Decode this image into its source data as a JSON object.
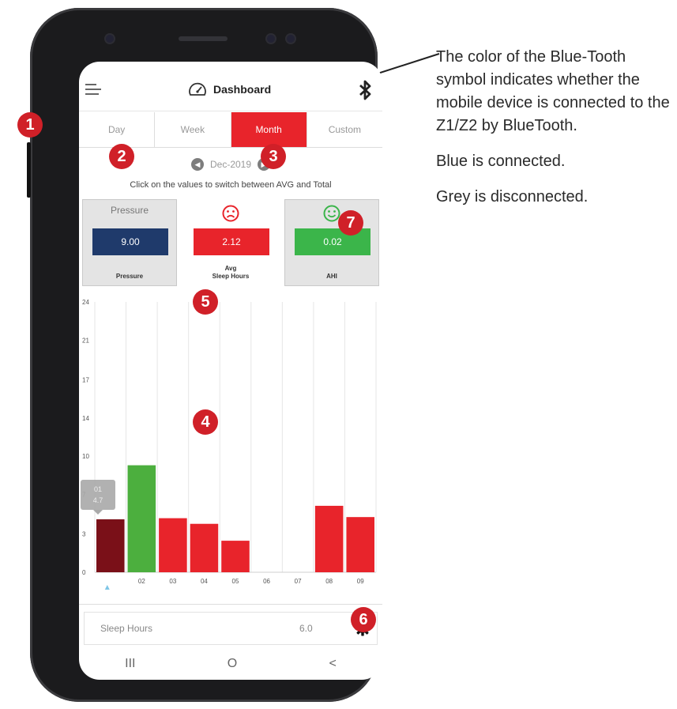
{
  "header": {
    "title": "Dashboard"
  },
  "tabs": [
    {
      "label": "Day",
      "active": false
    },
    {
      "label": "Week",
      "active": false
    },
    {
      "label": "Month",
      "active": true
    },
    {
      "label": "Custom",
      "active": false
    }
  ],
  "date_nav": {
    "current": "Dec-2019"
  },
  "instruction": "Click on the values to switch between AVG and Total",
  "cards": {
    "pressure": {
      "title": "Pressure",
      "value": "9.00",
      "label": "Pressure",
      "color": "#1f3a6b"
    },
    "sleep": {
      "value": "2.12",
      "label_line1": "Avg",
      "label_line2": "Sleep Hours",
      "color": "#e8242b",
      "face": "sad-face-icon"
    },
    "ahi": {
      "value": "0.02",
      "label": "AHI",
      "color": "#3bb54a",
      "face": "smiley-face-icon"
    }
  },
  "chart_data": {
    "type": "bar",
    "categories": [
      "01",
      "02",
      "03",
      "04",
      "05",
      "06",
      "07",
      "08",
      "09"
    ],
    "values": [
      4.7,
      9.5,
      4.8,
      4.3,
      2.8,
      0,
      0,
      5.9,
      4.9
    ],
    "colors": [
      "#7a1018",
      "#4caf3e",
      "#e8242b",
      "#e8242b",
      "#e8242b",
      "#e8242b",
      "#e8242b",
      "#e8242b",
      "#e8242b"
    ],
    "y_ticks": [
      "0",
      "3",
      "7",
      "10",
      "14",
      "17",
      "21",
      "24"
    ],
    "y_tick_values": [
      0,
      3.4,
      6.9,
      10.3,
      13.7,
      17.1,
      20.6,
      24
    ],
    "ylim": [
      0,
      24
    ],
    "tooltip": {
      "line1": "01",
      "line2": "4.7",
      "category_index": 0
    },
    "grid": true,
    "x_tick_labels": [
      "",
      "02",
      "03",
      "04",
      "05",
      "06",
      "07",
      "08",
      "09"
    ]
  },
  "sleep_row": {
    "label": "Sleep Hours",
    "value": "6.0"
  },
  "navbar": {
    "recents": "III",
    "home": "O",
    "back": "<"
  },
  "callouts": [
    "1",
    "2",
    "3",
    "4",
    "5",
    "6",
    "7"
  ],
  "annotation": {
    "paragraph1": "The color of the Blue-Tooth symbol indicates whether the mobile device is connected to the Z1/Z2 by BlueTooth.",
    "paragraph2": "Blue is connected.",
    "paragraph3": "Grey is disconnected."
  }
}
